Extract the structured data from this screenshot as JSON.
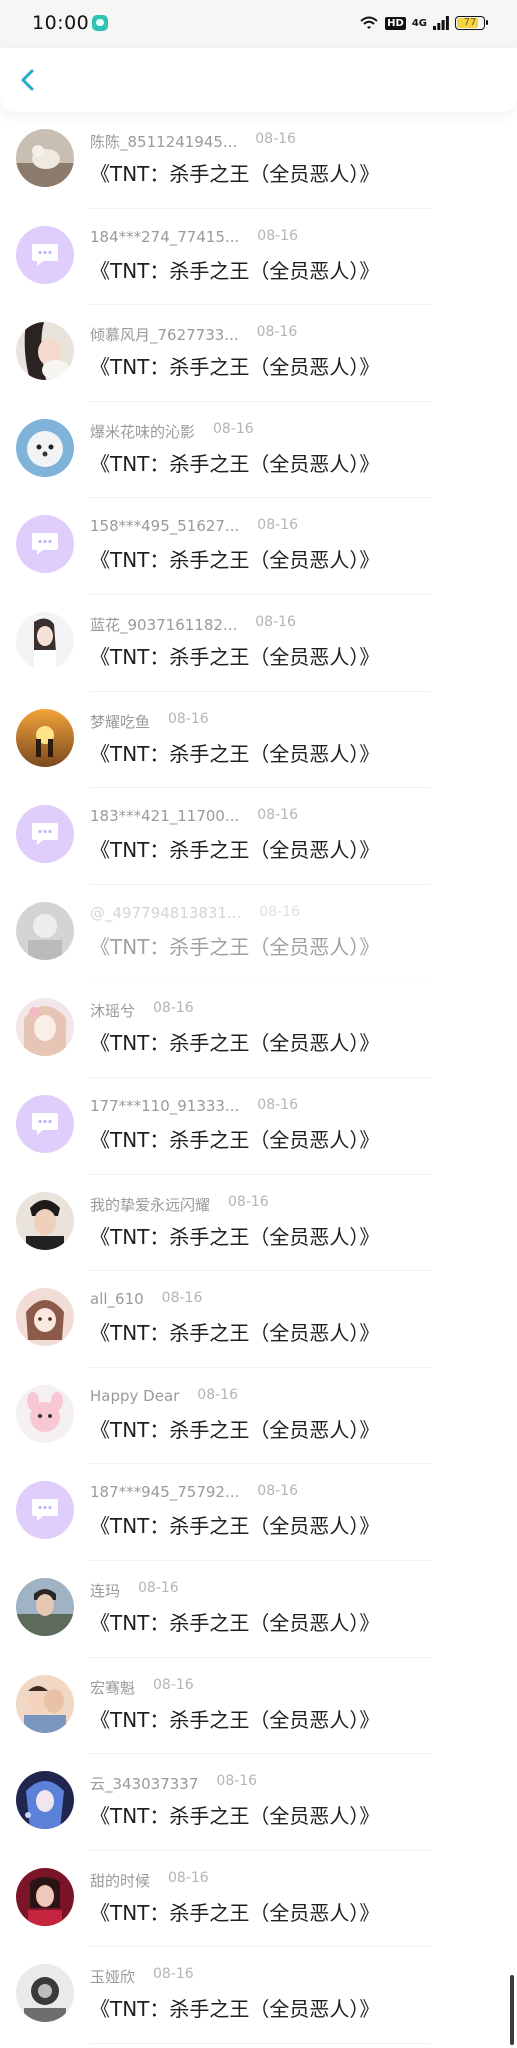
{
  "status_bar": {
    "time": "10:00",
    "hd": "HD",
    "network": "4G",
    "battery": "77"
  },
  "colors": {
    "back": "#2aa8c8",
    "placeholder_avatar": "#dfcdfb"
  },
  "rows": [
    {
      "name": "陈陈_8511241945...",
      "date": "08-16",
      "msg": "《TNT：杀手之王（全员恶人）》",
      "avatar": "photo-cat"
    },
    {
      "name": "184***274_77415...",
      "date": "08-16",
      "msg": "《TNT：杀手之王（全员恶人）》",
      "avatar": "placeholder"
    },
    {
      "name": "倾慕风月_7627733...",
      "date": "08-16",
      "msg": "《TNT：杀手之王（全员恶人）》",
      "avatar": "photo-girl-cat"
    },
    {
      "name": "爆米花味的沁影",
      "date": "08-16",
      "msg": "《TNT：杀手之王（全员恶人）》",
      "avatar": "photo-dog"
    },
    {
      "name": "158***495_51627...",
      "date": "08-16",
      "msg": "《TNT：杀手之王（全员恶人）》",
      "avatar": "placeholder"
    },
    {
      "name": "蓝花_9037161182...",
      "date": "08-16",
      "msg": "《TNT：杀手之王（全员恶人）》",
      "avatar": "photo-girl-white"
    },
    {
      "name": "梦耀吃鱼",
      "date": "08-16",
      "msg": "《TNT：杀手之王（全员恶人）》",
      "avatar": "photo-sunset"
    },
    {
      "name": "183***421_11700...",
      "date": "08-16",
      "msg": "《TNT：杀手之王（全员恶人）》",
      "avatar": "placeholder"
    },
    {
      "name": "@_497794813831...",
      "date": "08-16",
      "msg": "《TNT：杀手之王（全员恶人）》",
      "avatar": "photo-gray",
      "faded": true
    },
    {
      "name": "沐瑶兮",
      "date": "08-16",
      "msg": "《TNT：杀手之王（全员恶人）》",
      "avatar": "photo-anime-pink"
    },
    {
      "name": "177***110_91333...",
      "date": "08-16",
      "msg": "《TNT：杀手之王（全员恶人）》",
      "avatar": "placeholder"
    },
    {
      "name": "我的挚爱永远闪耀",
      "date": "08-16",
      "msg": "《TNT：杀手之王（全员恶人）》",
      "avatar": "photo-man"
    },
    {
      "name": "all_610",
      "date": "08-16",
      "msg": "《TNT：杀手之王（全员恶人）》",
      "avatar": "photo-cartoon-girl"
    },
    {
      "name": "Happy Dear",
      "date": "08-16",
      "msg": "《TNT：杀手之王（全员恶人）》",
      "avatar": "photo-pink-toy"
    },
    {
      "name": "187***945_75792...",
      "date": "08-16",
      "msg": "《TNT：杀手之王（全员恶人）》",
      "avatar": "placeholder"
    },
    {
      "name": "连玛",
      "date": "08-16",
      "msg": "《TNT：杀手之王（全员恶人）》",
      "avatar": "photo-boy"
    },
    {
      "name": "宏骞魁",
      "date": "08-16",
      "msg": "《TNT：杀手之王（全员恶人）》",
      "avatar": "photo-couple"
    },
    {
      "name": "云_343037337",
      "date": "08-16",
      "msg": "《TNT：杀手之王（全员恶人）》",
      "avatar": "photo-anime-blue"
    },
    {
      "name": "甜的时候",
      "date": "08-16",
      "msg": "《TNT：杀手之王（全员恶人）》",
      "avatar": "photo-red"
    },
    {
      "name": "玉娅欣",
      "date": "08-16",
      "msg": "《TNT：杀手之王（全员恶人）》",
      "avatar": "photo-bw"
    }
  ]
}
